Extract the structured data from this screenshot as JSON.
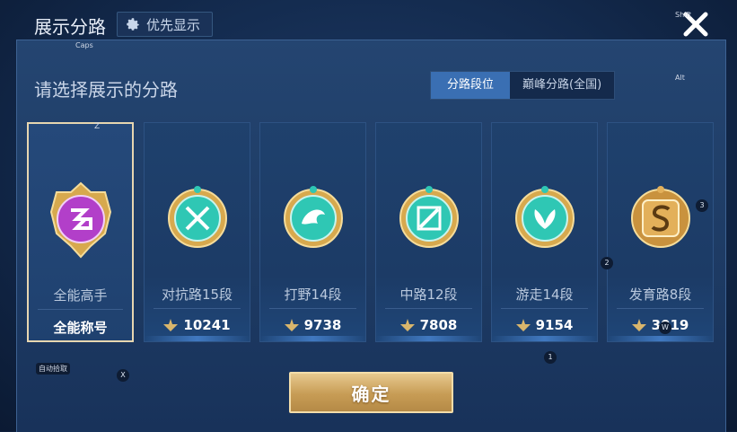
{
  "header": {
    "title": "展示分路",
    "priority_label": "优先显示"
  },
  "subtitle": "请选择展示的分路",
  "tabs": [
    {
      "label": "分路段位",
      "active": true
    },
    {
      "label": "巅峰分路(全国)",
      "active": false
    }
  ],
  "cards": [
    {
      "name": "全能高手",
      "score": "全能称号",
      "show_rank_icon": false,
      "selected": true,
      "emblem_color": "#b23fc9",
      "emblem_icon": "all-round-emblem-icon"
    },
    {
      "name": "对抗路15段",
      "score": "10241",
      "show_rank_icon": true,
      "selected": false,
      "emblem_color": "#2fc7b4",
      "emblem_icon": "clash-lane-emblem-icon"
    },
    {
      "name": "打野14段",
      "score": "9738",
      "show_rank_icon": true,
      "selected": false,
      "emblem_color": "#2fc7b4",
      "emblem_icon": "jungle-emblem-icon"
    },
    {
      "name": "中路12段",
      "score": "7808",
      "show_rank_icon": true,
      "selected": false,
      "emblem_color": "#2fc7b4",
      "emblem_icon": "mid-lane-emblem-icon"
    },
    {
      "name": "游走14段",
      "score": "9154",
      "show_rank_icon": true,
      "selected": false,
      "emblem_color": "#2fc7b4",
      "emblem_icon": "roam-emblem-icon"
    },
    {
      "name": "发育路8段",
      "score": "3019",
      "show_rank_icon": true,
      "selected": false,
      "emblem_color": "#e3b05a",
      "emblem_icon": "farm-lane-emblem-icon"
    }
  ],
  "confirm_label": "确定",
  "overlay_hints": {
    "shift": "Shift",
    "caps": "Caps",
    "alt": "Alt",
    "z": "Z",
    "x": "X",
    "n1": "1",
    "n2": "2",
    "n3": "3",
    "w": "W",
    "bottom_left": "自动拾取"
  },
  "colors": {
    "accent": "#3a6fb3",
    "gold": "#c79c55",
    "panel": "#1d3a63"
  }
}
